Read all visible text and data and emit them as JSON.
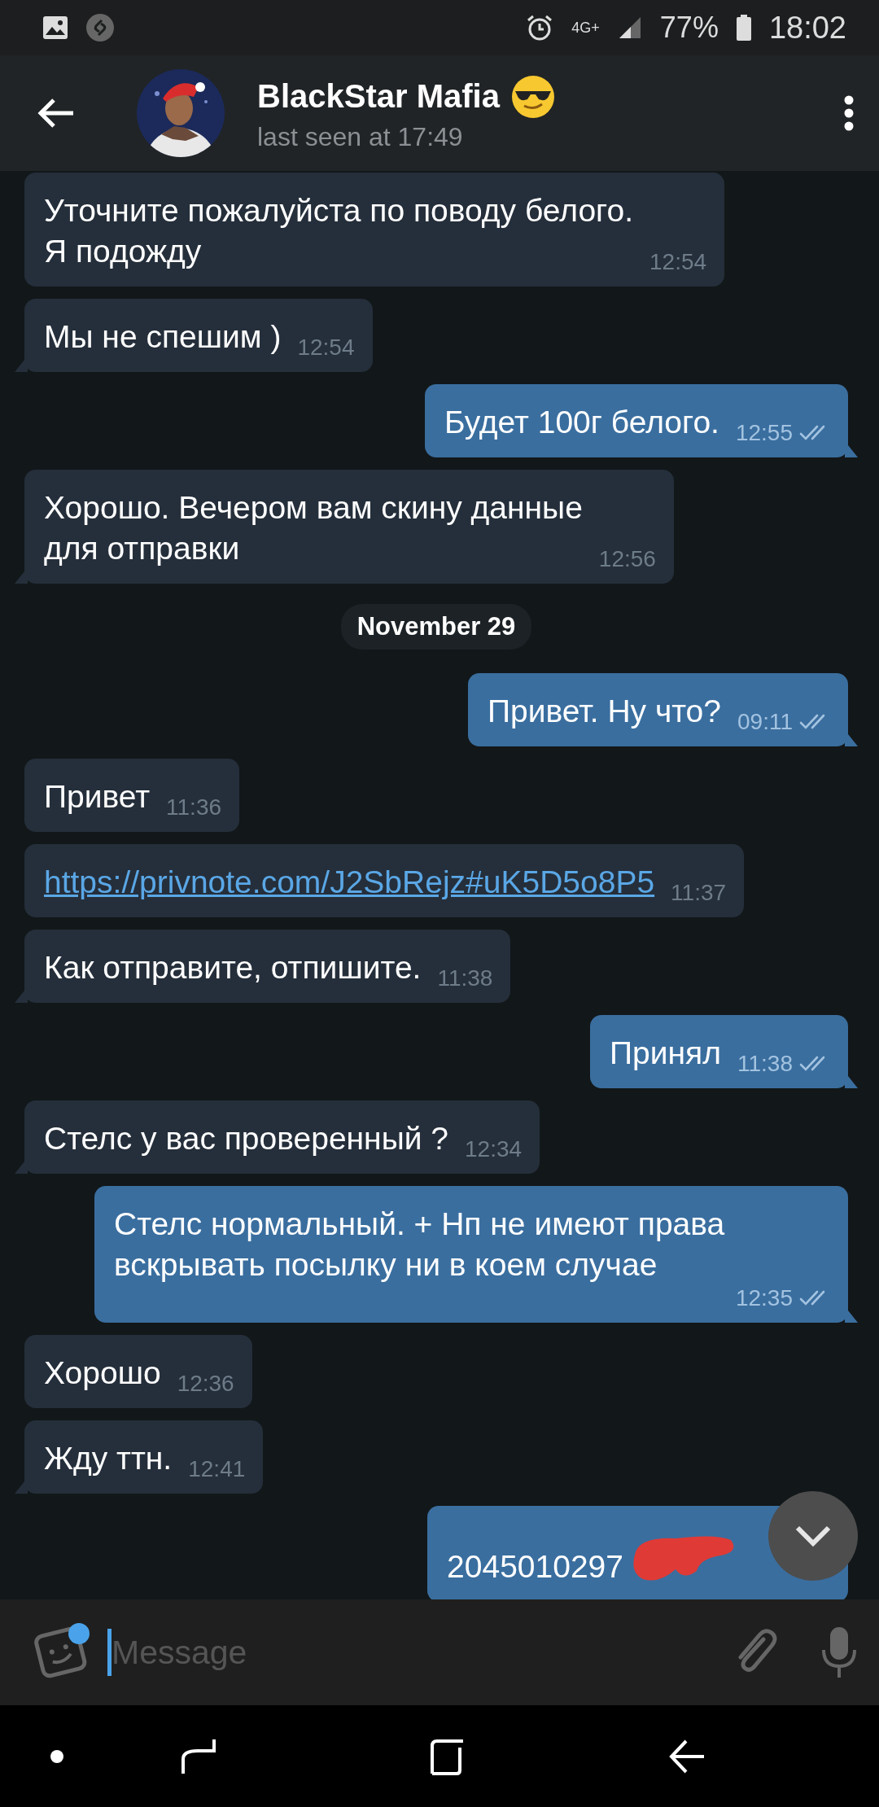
{
  "status_bar": {
    "network": "4G+",
    "battery": "77%",
    "time": "18:02"
  },
  "header": {
    "title": "BlackStar Mafia",
    "subtitle": "last seen at 17:49"
  },
  "messages": [
    {
      "kind": "message",
      "outgoing": false,
      "text": "Уточните пожалуйста по поводу белого.\nЯ подожду",
      "time": "12:54",
      "tail": false
    },
    {
      "kind": "message",
      "outgoing": false,
      "text": "Мы не спешим )",
      "time": "12:54",
      "tail": true
    },
    {
      "kind": "message",
      "outgoing": true,
      "text": "Будет 100г белого.",
      "time": "12:55",
      "tail": true,
      "read": true
    },
    {
      "kind": "message",
      "outgoing": false,
      "text": "Хорошо. Вечером вам скину данные\nдля отправки",
      "time": "12:56",
      "tail": true
    },
    {
      "kind": "date",
      "text": "November 29"
    },
    {
      "kind": "message",
      "outgoing": true,
      "text": "Привет. Ну что?",
      "time": "09:11",
      "tail": true,
      "read": true
    },
    {
      "kind": "message",
      "outgoing": false,
      "text": "Привет",
      "time": "11:36",
      "tail": false
    },
    {
      "kind": "link",
      "outgoing": false,
      "text": "https://privnote.com/J2SbRejz#uK5D5o8P5",
      "time": "11:37",
      "tail": false
    },
    {
      "kind": "message",
      "outgoing": false,
      "text": "Как отправите, отпишите.",
      "time": "11:38",
      "tail": true
    },
    {
      "kind": "message",
      "outgoing": true,
      "text": "Принял",
      "time": "11:38",
      "tail": true,
      "read": true
    },
    {
      "kind": "message",
      "outgoing": false,
      "text": "Стелс у вас проверенный ?",
      "time": "12:34",
      "tail": true
    },
    {
      "kind": "message",
      "outgoing": true,
      "text": "Стелс нормальный. + Нп не имеют права\nвскрывать посылку ни в коем случае",
      "time": "12:35",
      "tail": true,
      "read": true
    },
    {
      "kind": "message",
      "outgoing": false,
      "text": "Хорошо",
      "time": "12:36",
      "tail": false
    },
    {
      "kind": "message",
      "outgoing": false,
      "text": "Жду ттн.",
      "time": "12:41",
      "tail": true
    },
    {
      "kind": "message",
      "outgoing": true,
      "text": "2045010297",
      "tail": false,
      "redacted": true
    }
  ],
  "composer": {
    "placeholder": "Message",
    "sticker_badge": true
  }
}
